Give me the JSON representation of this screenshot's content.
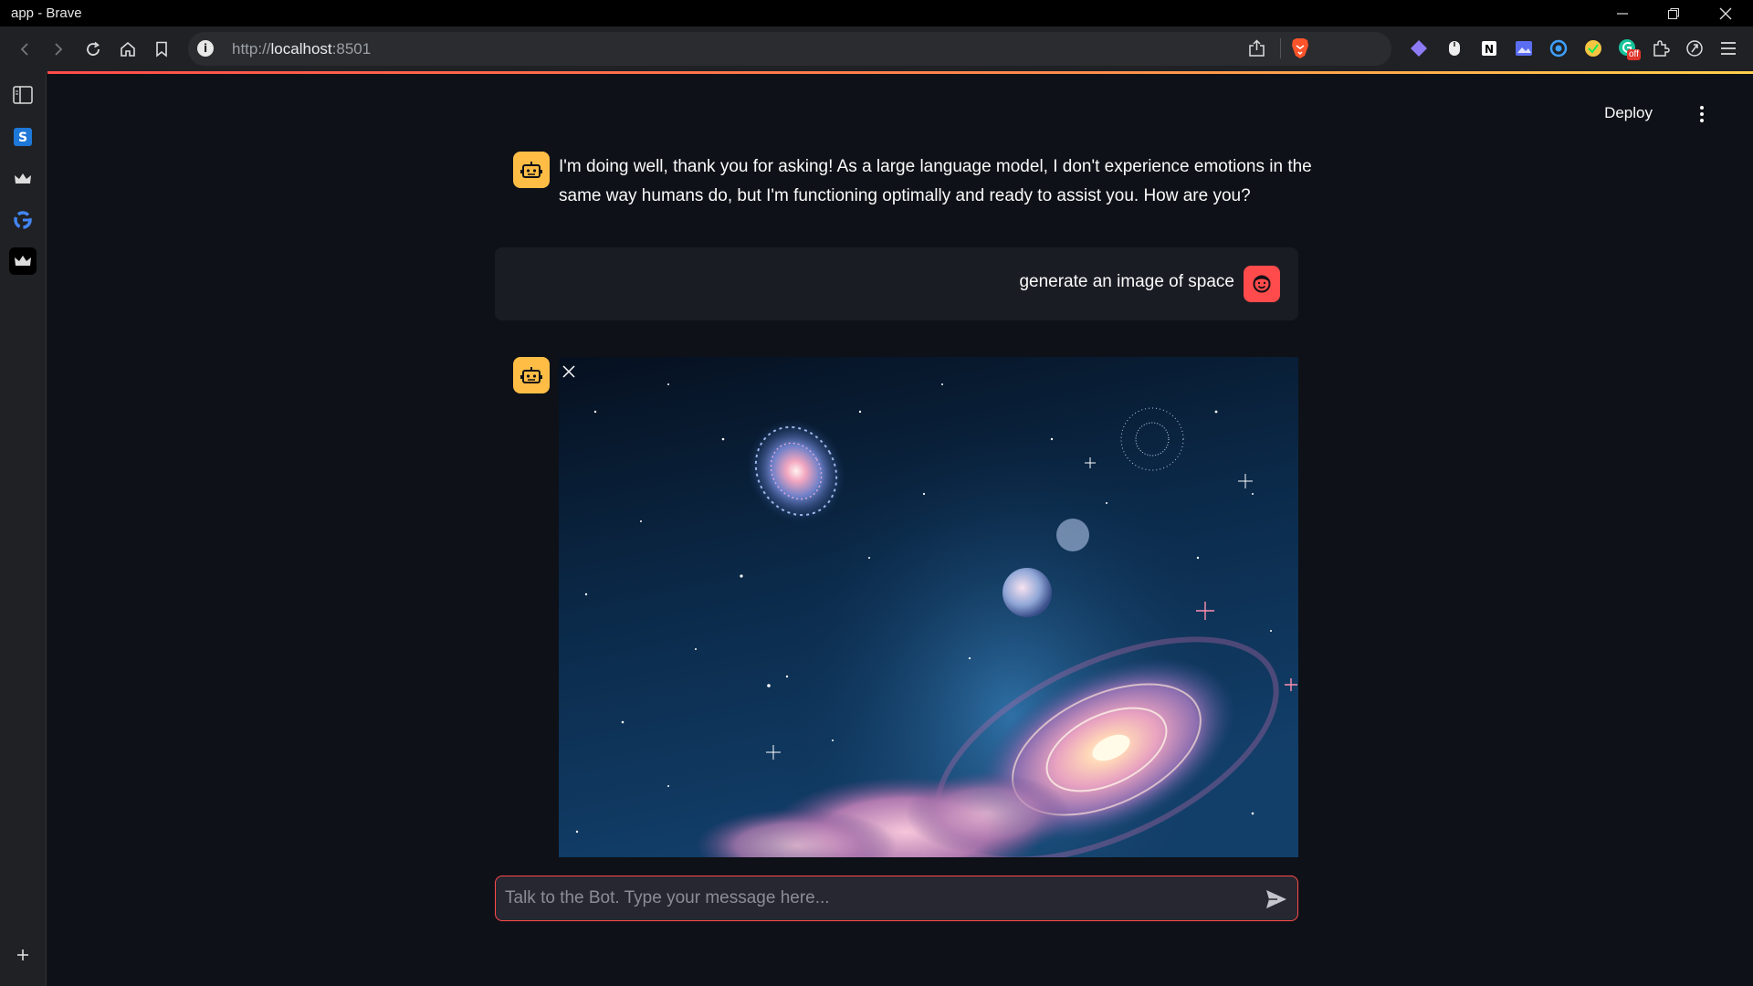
{
  "window": {
    "title": "app - Brave"
  },
  "browser": {
    "url_scheme": "http://",
    "url_host": "localhost",
    "url_port": ":8501",
    "extension_badge": "off"
  },
  "header": {
    "deploy_label": "Deploy"
  },
  "messages": [
    {
      "role": "assistant",
      "avatar": "robot-icon",
      "text": "I'm doing well, thank you for asking! As a large language model, I don't experience emotions in the same way humans do, but I'm functioning optimally and ready to assist you. How are you?"
    },
    {
      "role": "user",
      "avatar": "smiley-icon",
      "text": "generate an image of space"
    },
    {
      "role": "assistant",
      "avatar": "robot-icon",
      "content_type": "image",
      "image_subject": "space-galaxy-image"
    }
  ],
  "chat_input": {
    "placeholder": "Talk to the Bot. Type your message here...",
    "value": ""
  },
  "colors": {
    "accent": "#ff4b4b",
    "bot_avatar": "#ffbd45",
    "background": "#0e1117",
    "user_card": "#1a1c24"
  }
}
